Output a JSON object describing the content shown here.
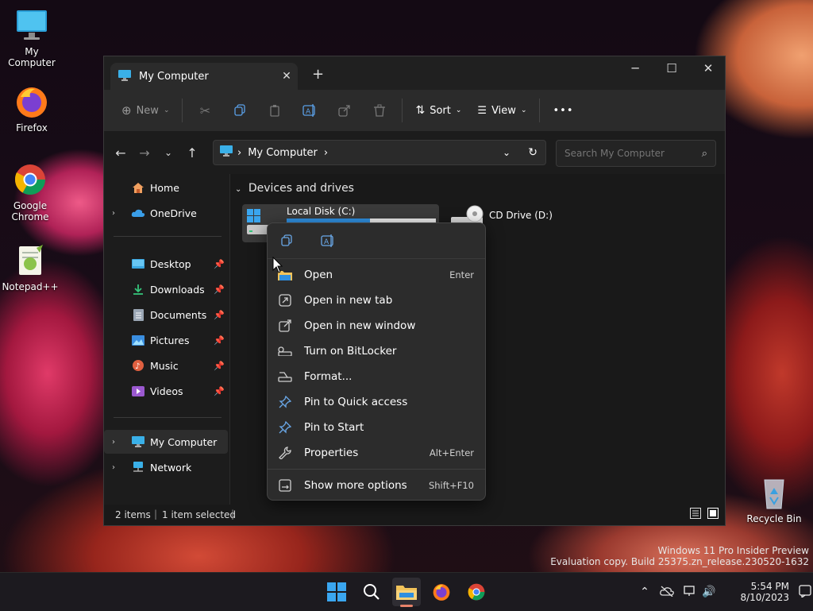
{
  "desktop": {
    "icons": [
      {
        "label": "My Computer"
      },
      {
        "label": "Firefox"
      },
      {
        "label": "Google Chrome"
      },
      {
        "label": "Notepad++"
      },
      {
        "label": "Recycle Bin"
      }
    ]
  },
  "window": {
    "tab_title": "My Computer",
    "toolbar": {
      "new_label": "New",
      "sort_label": "Sort",
      "view_label": "View",
      "more_label": "•••"
    },
    "address": {
      "path": "My Computer",
      "sep": "›"
    },
    "search": {
      "placeholder": "Search My Computer"
    },
    "sidebar": {
      "home": "Home",
      "onedrive": "OneDrive",
      "quick": [
        {
          "label": "Desktop"
        },
        {
          "label": "Downloads"
        },
        {
          "label": "Documents"
        },
        {
          "label": "Pictures"
        },
        {
          "label": "Music"
        },
        {
          "label": "Videos"
        }
      ],
      "mycomputer": "My Computer",
      "network": "Network"
    },
    "content": {
      "group": "Devices and drives",
      "drives": [
        {
          "label": "Local Disk (C:)",
          "used_fraction": 0.56
        },
        {
          "label": "CD Drive (D:)"
        }
      ]
    },
    "status": {
      "items": "2 items",
      "selected": "1 item selected"
    }
  },
  "context_menu": {
    "items": [
      {
        "label": "Open",
        "shortcut": "Enter"
      },
      {
        "label": "Open in new tab",
        "shortcut": ""
      },
      {
        "label": "Open in new window",
        "shortcut": ""
      },
      {
        "label": "Turn on BitLocker",
        "shortcut": ""
      },
      {
        "label": "Format...",
        "shortcut": ""
      },
      {
        "label": "Pin to Quick access",
        "shortcut": ""
      },
      {
        "label": "Pin to Start",
        "shortcut": ""
      },
      {
        "label": "Properties",
        "shortcut": "Alt+Enter"
      },
      {
        "label": "Show more options",
        "shortcut": "Shift+F10"
      }
    ]
  },
  "watermark": {
    "line1": "Windows 11 Pro Insider Preview",
    "line2": "Evaluation copy. Build 25375.zn_release.230520-1632"
  },
  "taskbar": {
    "time": "5:54 PM",
    "date": "8/10/2023"
  }
}
